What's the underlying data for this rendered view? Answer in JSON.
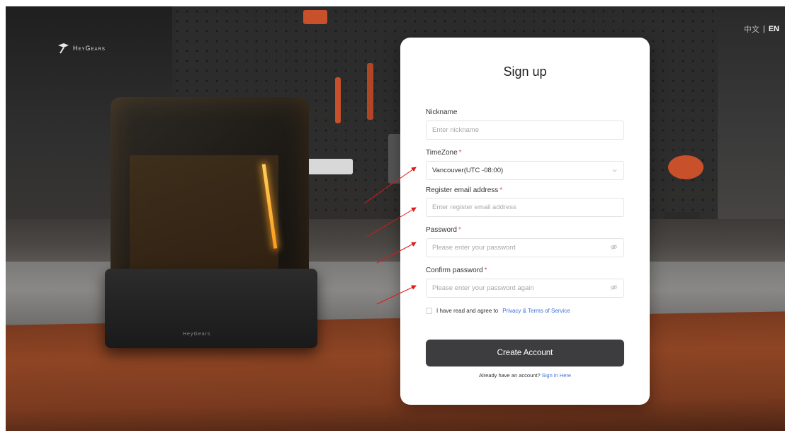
{
  "brand": {
    "name": "HeyGears",
    "base_label": "HeyGears"
  },
  "language": {
    "zh": "中文",
    "separator": "|",
    "en": "EN",
    "active": "EN"
  },
  "form": {
    "title": "Sign up",
    "nickname": {
      "label": "Nickname",
      "placeholder": "Enter nickname",
      "required": false
    },
    "timezone": {
      "label": "TimeZone",
      "value": "Vancouver(UTC -08:00)",
      "required": true
    },
    "email": {
      "label": "Register email address",
      "placeholder": "Enter register email address",
      "required": true
    },
    "password": {
      "label": "Password",
      "placeholder": "Please enter your password",
      "required": true
    },
    "confirm": {
      "label": "Confirm password",
      "placeholder": "Please enter your password again",
      "required": true
    },
    "required_mark": "*",
    "agree": {
      "text": "I have read and agree to",
      "link": "Privacy & Terms of Service",
      "checked": false
    },
    "submit_label": "Create Account",
    "signin": {
      "text": "Already have an account?",
      "link": "Sign in Here"
    }
  },
  "colors": {
    "accent_link": "#3f6fd6",
    "required": "#e55050",
    "button_bg": "#3d3d40",
    "annotation_arrow": "#e01818"
  },
  "icons": {
    "logo": "heygears-logo-icon",
    "select": "chevron-down-icon",
    "password_toggle": "eye-off-icon"
  }
}
